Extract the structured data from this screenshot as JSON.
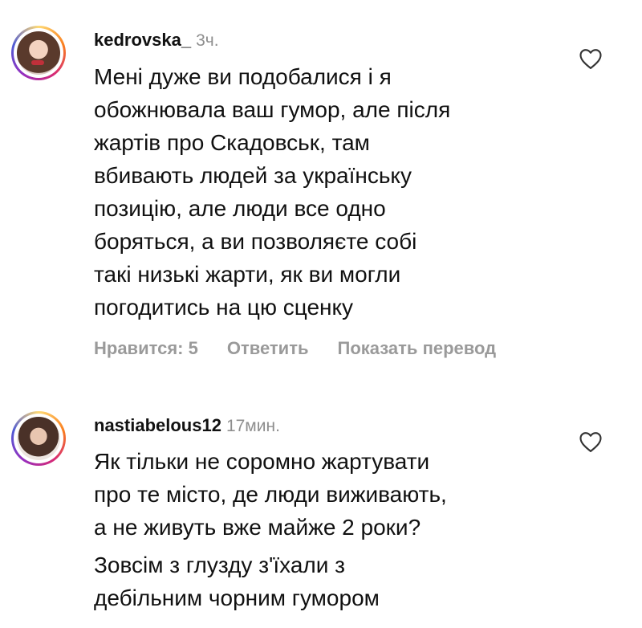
{
  "comments": [
    {
      "username": "kedrovska_",
      "time": "3ч.",
      "lines": [
        "Мені дуже ви подобалися і я",
        "обожнювала ваш гумор, але після",
        "жартів про Скадовськ, там",
        "вбивають людей за українську",
        "позицію, але люди все одно",
        "боряться, а ви позволяєте собі",
        "такі низькі жарти, як ви могли",
        "погодитись на цю сценку"
      ],
      "likes_label": "Нравится: 5",
      "reply_label": "Ответить",
      "translate_label": "Показать перевод"
    },
    {
      "username": "nastiabelous12",
      "time": "17мин.",
      "lines": [
        "Як тільки не соромно жартувати",
        "про те місто, де люди виживають,",
        "а не живуть вже майже 2 роки?"
      ],
      "extra_lines": [
        "Зовсім з глузду з'їхали з",
        "дебільним чорним гумором"
      ]
    }
  ],
  "icons": {
    "like": "heart-outline-icon"
  },
  "colors": {
    "text": "#111111",
    "muted": "#8e8e8e",
    "actions": "#9a9a9a"
  }
}
